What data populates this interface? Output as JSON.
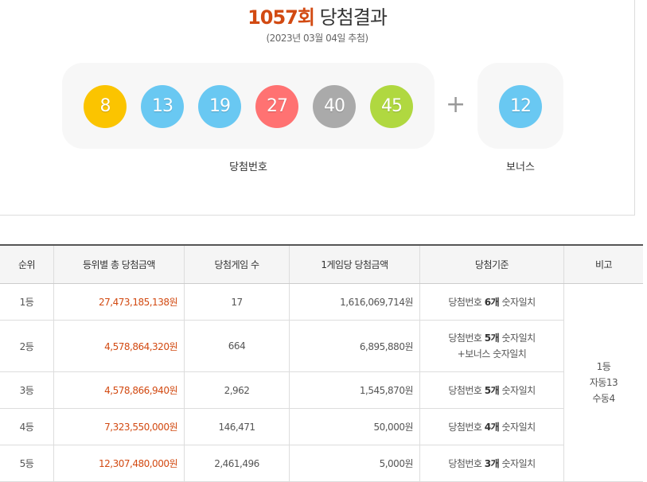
{
  "header": {
    "round": "1057회",
    "title_suffix": "당첨결과",
    "draw_date": "(2023년 03월 04일 추첨)"
  },
  "balls": [
    {
      "number": "8",
      "color": "#fbc400"
    },
    {
      "number": "13",
      "color": "#69c8f2"
    },
    {
      "number": "19",
      "color": "#69c8f2"
    },
    {
      "number": "27",
      "color": "#ff7272"
    },
    {
      "number": "40",
      "color": "#aaaaaa"
    },
    {
      "number": "45",
      "color": "#b0d840"
    }
  ],
  "plus_sign": "+",
  "bonus_ball": {
    "number": "12",
    "color": "#69c8f2"
  },
  "captions": {
    "winning_numbers": "당첨번호",
    "bonus": "보너스"
  },
  "table": {
    "headers": [
      "순위",
      "등위별 총 당첨금액",
      "당첨게임 수",
      "1게임당 당첨금액",
      "당첨기준",
      "비고"
    ],
    "rows": [
      {
        "rank": "1등",
        "total": "27,473,185,138원",
        "winners": "17",
        "per_game": "1,616,069,714원",
        "criteria_pre": "당첨번호 ",
        "criteria_bold": "6개",
        "criteria_post": " 숫자일치",
        "criteria_extra": ""
      },
      {
        "rank": "2등",
        "total": "4,578,864,320원",
        "winners": "664",
        "per_game": "6,895,880원",
        "criteria_pre": "당첨번호 ",
        "criteria_bold": "5개",
        "criteria_post": " 숫자일치",
        "criteria_extra": "+보너스 숫자일치"
      },
      {
        "rank": "3등",
        "total": "4,578,866,940원",
        "winners": "2,962",
        "per_game": "1,545,870원",
        "criteria_pre": "당첨번호 ",
        "criteria_bold": "5개",
        "criteria_post": " 숫자일치",
        "criteria_extra": ""
      },
      {
        "rank": "4등",
        "total": "7,323,550,000원",
        "winners": "146,471",
        "per_game": "50,000원",
        "criteria_pre": "당첨번호 ",
        "criteria_bold": "4개",
        "criteria_post": " 숫자일치",
        "criteria_extra": ""
      },
      {
        "rank": "5등",
        "total": "12,307,480,000원",
        "winners": "2,461,496",
        "per_game": "5,000원",
        "criteria_pre": "당첨번호 ",
        "criteria_bold": "3개",
        "criteria_post": " 숫자일치",
        "criteria_extra": ""
      }
    ],
    "note_lines": [
      "1등",
      "자동13",
      "수동4"
    ]
  }
}
